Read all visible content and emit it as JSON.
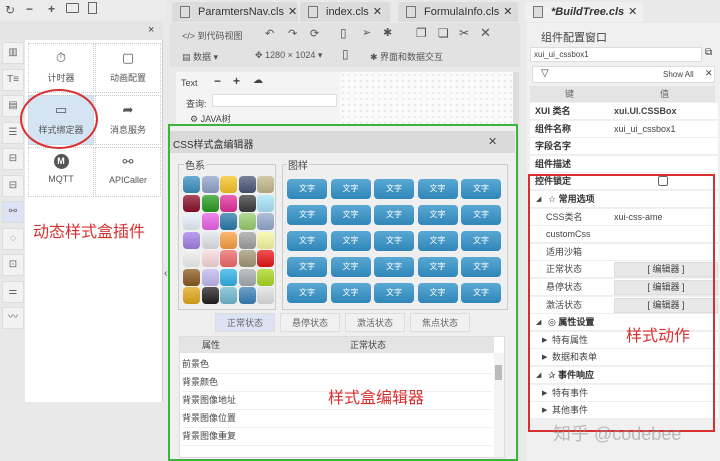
{
  "left_toolbar": {
    "icons": [
      "refresh-icon",
      "minus-icon",
      "plus-icon",
      "folder-icon",
      "file-icon"
    ],
    "close": "×"
  },
  "palette": {
    "items": [
      {
        "label": "计时器",
        "icon": "⏱"
      },
      {
        "label": "动画配置",
        "icon": "▢"
      },
      {
        "label": "样式绑定器",
        "icon": "▭"
      },
      {
        "label": "消息服务",
        "icon": "➦"
      },
      {
        "label": "MQTT",
        "icon": "M"
      },
      {
        "label": "APICaller",
        "icon": "⚯"
      }
    ],
    "annotation": "动态样式盒插件"
  },
  "side_icons": [
    "▥",
    "T≡",
    "▤",
    "☰",
    "⊟",
    "⊟",
    "⚯",
    "◌",
    "⊡",
    "⚌",
    "〰"
  ],
  "tabs": [
    {
      "label": "ParamtersNav.cls",
      "close": "✕"
    },
    {
      "label": "index.cls",
      "close": "✕"
    },
    {
      "label": "FormulaInfo.cls",
      "close": "✕"
    },
    {
      "label": "*BuildTree.cls",
      "close": "✕"
    }
  ],
  "toolbar": {
    "code_view": "</> 到代码视图",
    "data": "数据",
    "resolution": "1280 × 1024",
    "interaction": "界面和数据交互"
  },
  "tree": {
    "search_label": "查询:",
    "item": "JAVA树",
    "title": "Text"
  },
  "dialog": {
    "title": "CSS样式盒编辑器",
    "close": "✕",
    "colors_label": "色系",
    "patterns_label": "图样",
    "pattern_text": "文字",
    "colors": [
      "#3a8fc0",
      "#8fa3c8",
      "#f5c426",
      "#4a5878",
      "#c2b88a",
      "#8a0f2a",
      "#2a9a20",
      "#e0309a",
      "#3a3a3a",
      "#a8e4f8",
      "#e8f0f8",
      "#e860e8",
      "#2a7aa8",
      "#98cc70",
      "#94a8cc",
      "#a080e8",
      "#e0e4e8",
      "#f8a040",
      "#a0a0a0",
      "#f8f8a0",
      "#f0f0f0",
      "#f8d8dc",
      "#f06868",
      "#a09878",
      "#e81818",
      "#8a5a20",
      "#c0b8f0",
      "#30b0e8",
      "#a8acb0",
      "#a8d820",
      "#e0a818",
      "#202020",
      "#70b8d0",
      "#3a80b8",
      "#e0e0e0"
    ],
    "states": [
      "正常状态",
      "悬停状态",
      "激活状态",
      "焦点状态"
    ],
    "table_headers": [
      "属性",
      "正常状态"
    ],
    "table_rows": [
      "前景色",
      "背景颜色",
      "背景图像地址",
      "背景图像位置",
      "背景图像重复"
    ],
    "annotation": "样式盒编辑器"
  },
  "config": {
    "title": "组件配置窗口",
    "name_input": "xui_ui_cssbox1",
    "filter": "Show All",
    "headers": [
      "键",
      "值"
    ],
    "rows": [
      {
        "k": "XUI 类名",
        "v": "xui.UI.CSSBox"
      },
      {
        "k": "组件名称",
        "v": "xui_ui_cssbox1"
      },
      {
        "k": "字段名字",
        "v": ""
      },
      {
        "k": "组件描述",
        "v": ""
      },
      {
        "k": "控件锁定",
        "v": ""
      }
    ],
    "sections": {
      "common": "☆ 常用选项",
      "attrs": "◎ 属性设置",
      "events": "✰ 事件响应"
    },
    "common_rows": [
      {
        "k": "CSS类名",
        "v": "xui-css-ame"
      },
      {
        "k": "customCss",
        "v": ""
      },
      {
        "k": "适用沙箱",
        "v": ""
      },
      {
        "k": "正常状态",
        "v": "[ 编辑器 ]"
      },
      {
        "k": "悬停状态",
        "v": "[ 编辑器 ]"
      },
      {
        "k": "激活状态",
        "v": "[ 编辑器 ]"
      }
    ],
    "attr_rows": [
      "特有属性",
      "数据和表单"
    ],
    "event_rows": [
      "特有事件",
      "其他事件"
    ],
    "annotation": "样式动作"
  },
  "watermark": "知乎 @codebee",
  "accent": {
    "highlight_red": "#d83030",
    "green": "#3cb43c"
  }
}
